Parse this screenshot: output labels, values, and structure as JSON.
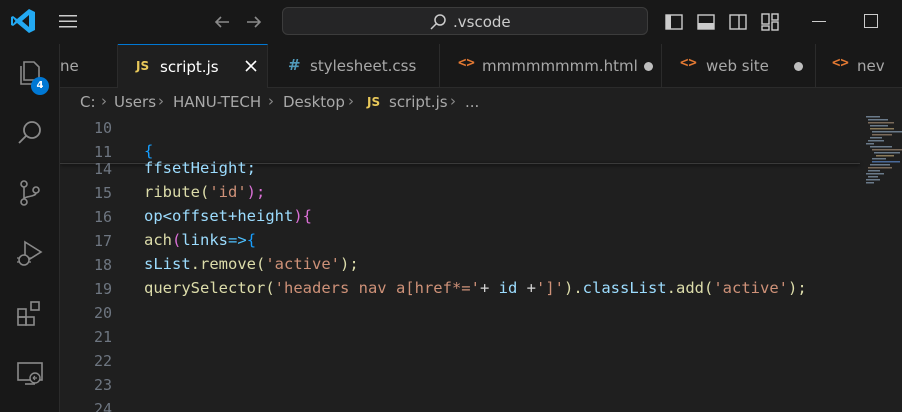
{
  "titlebar": {
    "search_text": ".vscode"
  },
  "activity": {
    "explorer_badge": "4"
  },
  "tabs": [
    {
      "label": "ne",
      "type": "truncated"
    },
    {
      "label": "script.js",
      "type": "js",
      "active": true
    },
    {
      "label": "stylesheet.css",
      "type": "css"
    },
    {
      "label": "mmmmmmmm.html",
      "type": "html",
      "modified": true
    },
    {
      "label": "web site",
      "type": "html",
      "modified": true
    },
    {
      "label": "nev",
      "type": "html"
    }
  ],
  "tab_icons": {
    "js": "JS",
    "css": "#",
    "html": "<>"
  },
  "breadcrumb": [
    "C:",
    "Users",
    "HANU-TECH",
    "Desktop",
    "script.js",
    "..."
  ],
  "editor": {
    "line_numbers": [
      "10",
      "11",
      "14",
      "15",
      "16",
      "17",
      "18",
      "19",
      "20",
      "21",
      "22",
      "23",
      "24"
    ]
  },
  "code": {
    "l11": "{",
    "l14": "ffsetHeight;",
    "l15a": "ribute(",
    "l15b": "'id'",
    "l15c": ");",
    "l16a": "op<offset+height",
    "l16b": "){",
    "l17a": "ach",
    "l17b": "(",
    "l17c": "links",
    "l17d": "=>",
    "l17e": "{",
    "l18a": "sList",
    "l18b": ".remove(",
    "l18c": "'active'",
    "l18d": ");",
    "l19a": "querySelector(",
    "l19b": "'headers nav a[href*='",
    "l19c": "+ ",
    "l19d": "id",
    "l19e": " +",
    "l19f": "']'",
    "l19g": ").",
    "l19h": "classList",
    "l19i": ".add(",
    "l19j": "'active'",
    "l19k": ");"
  },
  "colors": {
    "accent": "#0078d4",
    "editor_bg": "#1f1f1f",
    "chrome_bg": "#181818"
  }
}
